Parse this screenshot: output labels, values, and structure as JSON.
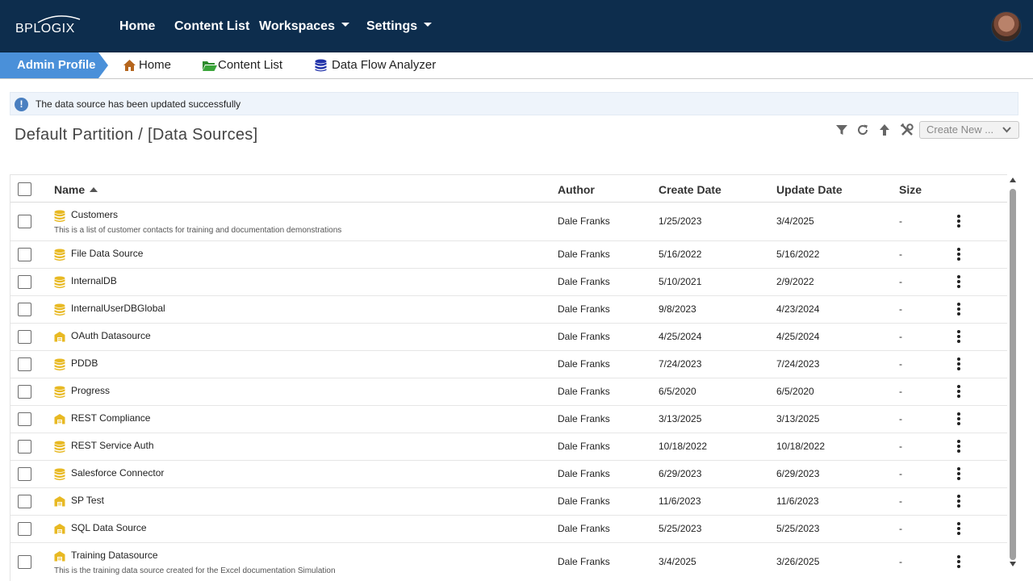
{
  "nav": {
    "logo": "BPLOGIX",
    "items": [
      {
        "label": "Home"
      },
      {
        "label": "Content List"
      },
      {
        "label": "Workspaces"
      },
      {
        "label": "Settings"
      }
    ]
  },
  "breadcrumb": {
    "profile": "Admin Profile",
    "home": "Home",
    "content_list": "Content List",
    "data_flow": "Data Flow Analyzer"
  },
  "alert": {
    "message": "The data source has been updated successfully"
  },
  "page": {
    "title": "Default Partition / [Data Sources]",
    "create_new": "Create New ..."
  },
  "table": {
    "columns": {
      "name": "Name",
      "author": "Author",
      "create_date": "Create Date",
      "update_date": "Update Date",
      "size": "Size"
    },
    "rows": [
      {
        "name": "Customers",
        "desc": "This is a list of customer contacts for training and documentation demonstrations",
        "icon": "database",
        "author": "Dale Franks",
        "created": "1/25/2023",
        "updated": "3/4/2025",
        "size": "-"
      },
      {
        "name": "File Data Source",
        "icon": "database",
        "author": "Dale Franks",
        "created": "5/16/2022",
        "updated": "5/16/2022",
        "size": "-"
      },
      {
        "name": "InternalDB",
        "icon": "database",
        "author": "Dale Franks",
        "created": "5/10/2021",
        "updated": "2/9/2022",
        "size": "-"
      },
      {
        "name": "InternalUserDBGlobal",
        "icon": "database",
        "author": "Dale Franks",
        "created": "9/8/2023",
        "updated": "4/23/2024",
        "size": "-"
      },
      {
        "name": "OAuth Datasource",
        "icon": "warehouse",
        "author": "Dale Franks",
        "created": "4/25/2024",
        "updated": "4/25/2024",
        "size": "-"
      },
      {
        "name": "PDDB",
        "icon": "database",
        "author": "Dale Franks",
        "created": "7/24/2023",
        "updated": "7/24/2023",
        "size": "-"
      },
      {
        "name": "Progress",
        "icon": "database",
        "author": "Dale Franks",
        "created": "6/5/2020",
        "updated": "6/5/2020",
        "size": "-"
      },
      {
        "name": "REST Compliance",
        "icon": "warehouse",
        "author": "Dale Franks",
        "created": "3/13/2025",
        "updated": "3/13/2025",
        "size": "-"
      },
      {
        "name": "REST Service Auth",
        "icon": "database",
        "author": "Dale Franks",
        "created": "10/18/2022",
        "updated": "10/18/2022",
        "size": "-"
      },
      {
        "name": "Salesforce Connector",
        "icon": "database",
        "author": "Dale Franks",
        "created": "6/29/2023",
        "updated": "6/29/2023",
        "size": "-"
      },
      {
        "name": "SP Test",
        "icon": "warehouse",
        "author": "Dale Franks",
        "created": "11/6/2023",
        "updated": "11/6/2023",
        "size": "-"
      },
      {
        "name": "SQL Data Source",
        "icon": "warehouse",
        "author": "Dale Franks",
        "created": "5/25/2023",
        "updated": "5/25/2023",
        "size": "-"
      },
      {
        "name": "Training Datasource",
        "desc": "This is the training data source created for the Excel documentation Simulation",
        "icon": "warehouse",
        "author": "Dale Franks",
        "created": "3/4/2025",
        "updated": "3/26/2025",
        "size": "-"
      }
    ]
  },
  "colors": {
    "nav_bg": "#0d2d4d",
    "profile_tab": "#4a90d9",
    "icon_yellow": "#e8b923",
    "home_icon": "#b5651d",
    "folder_icon": "#2e8b2e",
    "db_icon_blue": "#2233aa"
  }
}
